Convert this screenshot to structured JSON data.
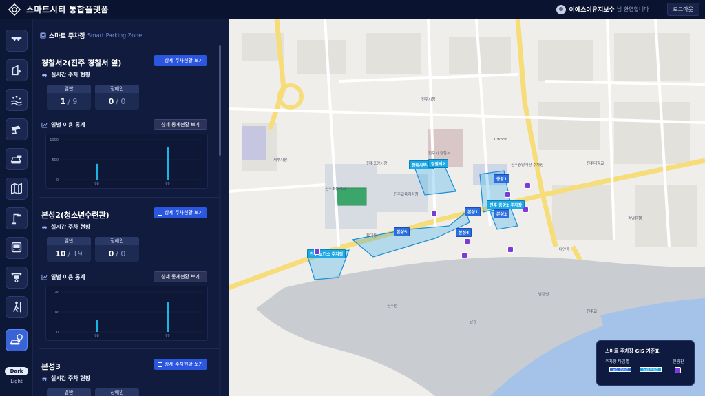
{
  "app": {
    "title": "스마트시티 통합플랫폼"
  },
  "user": {
    "name": "이에스이유지보수",
    "greeting": "님 환영합니다",
    "logout": "로그아웃"
  },
  "theme": {
    "dark": "Dark",
    "light": "Light"
  },
  "panel": {
    "title": "스마트 주차장",
    "subtitle": "Smart Parking Zone"
  },
  "labels": {
    "realtime": "실시간 주차 현황",
    "daily": "일별 이용 통계",
    "general": "일반",
    "disabled": "장애인",
    "detail_btn": "상세 주차현황 보기",
    "stat_btn": "상세 통계현황 보기"
  },
  "lots": [
    {
      "name": "경찰서2(진주 경찰서 옆)",
      "general": {
        "used": "1",
        "total": "9"
      },
      "disabled": {
        "used": "0",
        "total": "0"
      },
      "chart": {
        "type": "bar",
        "yticks": [
          "1000",
          "500",
          "0"
        ],
        "xticks": [
          "08",
          "09"
        ],
        "ylim": [
          0,
          1000
        ],
        "values": [
          400,
          820
        ]
      }
    },
    {
      "name": "본성2(청소년수련관)",
      "general": {
        "used": "10",
        "total": "19"
      },
      "disabled": {
        "used": "0",
        "total": "0"
      },
      "chart": {
        "type": "bar",
        "yticks": [
          "2k",
          "1k",
          "0"
        ],
        "xticks": [
          "08",
          "09"
        ],
        "ylim": [
          0,
          2000
        ],
        "values": [
          600,
          1500
        ]
      }
    },
    {
      "name": "본성3",
      "general": {
        "used": "",
        "total": ""
      },
      "disabled": {
        "used": "",
        "total": ""
      }
    }
  ],
  "map": {
    "labels": [
      {
        "t": "진주시청"
      },
      {
        "t": "진주중앙시장"
      },
      {
        "t": "진주교육지원청"
      },
      {
        "t": "진주초등학교"
      },
      {
        "t": "진주성"
      },
      {
        "t": "남강"
      },
      {
        "t": "서부시장"
      },
      {
        "t": "진주중앙시장 주차장"
      },
      {
        "t": "대안동"
      },
      {
        "t": "진주대학교"
      },
      {
        "t": "장대동"
      },
      {
        "t": "남강변"
      },
      {
        "t": "진주교"
      },
      {
        "t": "T world"
      },
      {
        "t": "경남은행"
      },
      {
        "t": "진주시 경찰서"
      }
    ],
    "zones": [
      "장대사무서",
      "경찰서2",
      "중앙1",
      "진주 중앙2 주차장",
      "본성1",
      "본성2",
      "본성4",
      "본성5",
      "진주 보건소 주차장"
    ],
    "legend": {
      "title": "스마트 주차장 GIS 기준표",
      "type_label": "주차장 타입별",
      "ev_label": "전광판",
      "chip1": "노상 주차장",
      "chip2": "노외 주차장"
    }
  },
  "colors": {
    "accent": "#2a56e0",
    "bar": "#19b5e6",
    "zone": "#1da9e6",
    "marker": "#7b3ad9"
  },
  "icons": [
    "cctv-icon",
    "disaster-icon",
    "air-quality-icon",
    "security-camera-icon",
    "traffic-icon",
    "map-icon",
    "streetlight-icon",
    "bus-icon",
    "drone-icon",
    "pedestrian-icon",
    "parking-icon"
  ]
}
